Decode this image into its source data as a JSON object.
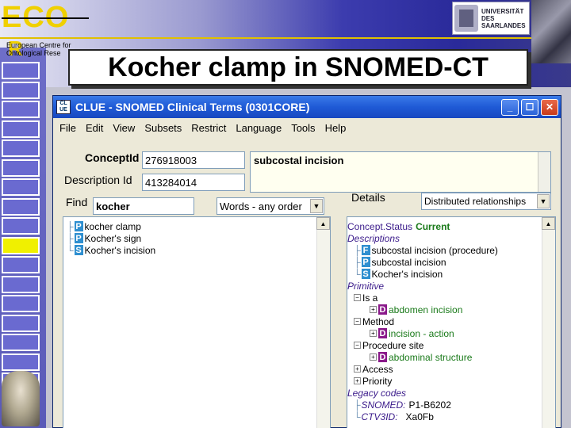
{
  "slide": {
    "logo_main": "ECO",
    "logo_second": "R",
    "org_line1": "European Centre for",
    "org_line2": "Ontological Rese",
    "university_line1": "UNIVERSITÄT",
    "university_line2": "DES",
    "university_line3": "SAARLANDES",
    "title": "Kocher clamp in SNOMED-CT",
    "nav_count": 17,
    "active_nav_index": 9
  },
  "window": {
    "app_icon_text": "CL UE",
    "title": "CLUE - SNOMED Clinical Terms (0301CORE)",
    "minimize": "_",
    "maximize": "☐",
    "close": "✕",
    "menu": [
      "File",
      "Edit",
      "View",
      "Subsets",
      "Restrict",
      "Language",
      "Tools",
      "Help"
    ],
    "concept_id_label": "ConceptId",
    "concept_id_value": "276918003",
    "description_id_label": "Description Id",
    "description_id_value": "413284014",
    "term_value": "subcostal incision",
    "find_label": "Find",
    "find_value": "kocher",
    "find_order": "Words - any order",
    "details_label": "Details",
    "details_mode": "Distributed relationships",
    "results": [
      {
        "type": "P",
        "text": "kocher clamp"
      },
      {
        "type": "P",
        "text": "Kocher's sign"
      },
      {
        "type": "S",
        "text": "Kocher's incision"
      }
    ],
    "details": {
      "status_label": "Concept.Status",
      "status_value": "Current",
      "descriptions_label": "Descriptions",
      "descriptions": [
        {
          "type": "F",
          "text": "subcostal incision (procedure)"
        },
        {
          "type": "P",
          "text": "subcostal incision"
        },
        {
          "type": "S",
          "text": "Kocher's incision"
        }
      ],
      "primitive_label": "Primitive",
      "is_a_label": "Is a",
      "is_a_value": "abdomen incision",
      "method_label": "Method",
      "method_value": "incision - action",
      "site_label": "Procedure site",
      "site_value": "abdominal structure",
      "access_label": "Access",
      "priority_label": "Priority",
      "legacy_label": "Legacy codes",
      "snomed_label": "SNOMED:",
      "snomed_value": "P1-B6202",
      "ctv_label": "CTV3ID:",
      "ctv_value": "Xa0Fb"
    }
  }
}
